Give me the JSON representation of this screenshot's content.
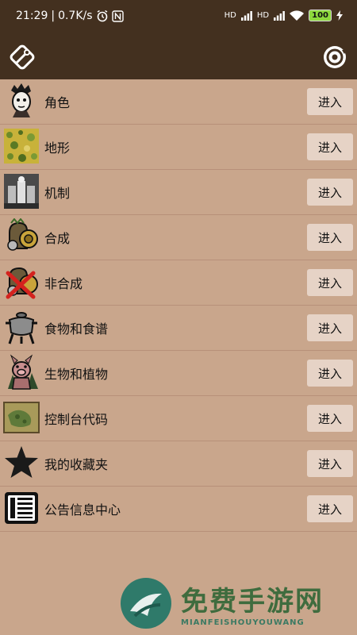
{
  "status_bar": {
    "time": "21:29",
    "network_speed": "0.7K/s",
    "battery": "100",
    "signal1": "HD",
    "signal2": "HD",
    "icons": [
      "alarm-icon",
      "nfc-icon",
      "signal-icon",
      "wifi-icon",
      "battery-icon",
      "charging-icon"
    ]
  },
  "app_bar": {
    "left_icon": "wrench-icon",
    "right_icon": "refresh-icon"
  },
  "menu": {
    "items": [
      {
        "label": "角色",
        "button": "进入",
        "icon": "character-icon"
      },
      {
        "label": "地形",
        "button": "进入",
        "icon": "terrain-icon"
      },
      {
        "label": "机制",
        "button": "进入",
        "icon": "mechanism-icon"
      },
      {
        "label": "合成",
        "button": "进入",
        "icon": "craft-icon"
      },
      {
        "label": "非合成",
        "button": "进入",
        "icon": "non-craft-icon"
      },
      {
        "label": "食物和食谱",
        "button": "进入",
        "icon": "crockpot-icon"
      },
      {
        "label": "生物和植物",
        "button": "进入",
        "icon": "creature-icon"
      },
      {
        "label": "控制台代码",
        "button": "进入",
        "icon": "console-map-icon"
      },
      {
        "label": "我的收藏夹",
        "button": "进入",
        "icon": "star-icon"
      },
      {
        "label": "公告信息中心",
        "button": "进入",
        "icon": "notice-icon"
      }
    ]
  },
  "watermark": {
    "title": "免费手游网",
    "subtitle": "MIANFEISHOUYOUWANG"
  },
  "colors": {
    "bar": "#43301f",
    "background": "#c9a68c",
    "button": "#e6d3c6"
  }
}
